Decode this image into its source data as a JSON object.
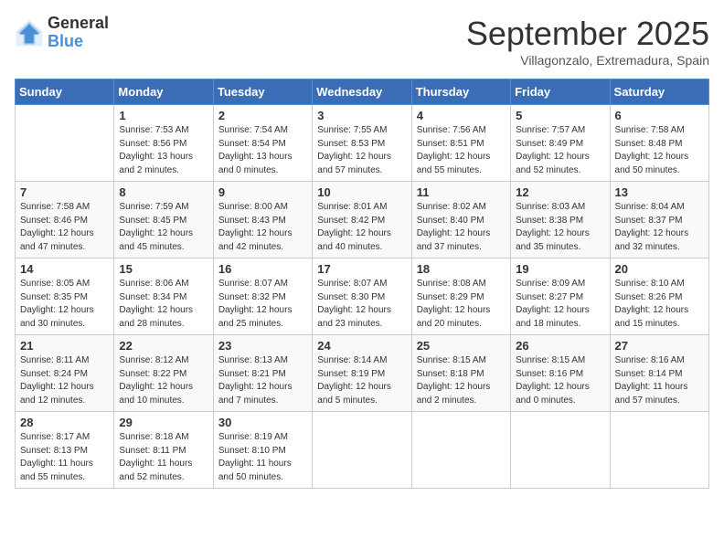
{
  "logo": {
    "general": "General",
    "blue": "Blue"
  },
  "title": "September 2025",
  "subtitle": "Villagonzalo, Extremadura, Spain",
  "weekdays": [
    "Sunday",
    "Monday",
    "Tuesday",
    "Wednesday",
    "Thursday",
    "Friday",
    "Saturday"
  ],
  "weeks": [
    [
      {
        "day": null
      },
      {
        "day": "1",
        "sunrise": "7:53 AM",
        "sunset": "8:56 PM",
        "daylight": "13 hours and 2 minutes."
      },
      {
        "day": "2",
        "sunrise": "7:54 AM",
        "sunset": "8:54 PM",
        "daylight": "13 hours and 0 minutes."
      },
      {
        "day": "3",
        "sunrise": "7:55 AM",
        "sunset": "8:53 PM",
        "daylight": "12 hours and 57 minutes."
      },
      {
        "day": "4",
        "sunrise": "7:56 AM",
        "sunset": "8:51 PM",
        "daylight": "12 hours and 55 minutes."
      },
      {
        "day": "5",
        "sunrise": "7:57 AM",
        "sunset": "8:49 PM",
        "daylight": "12 hours and 52 minutes."
      },
      {
        "day": "6",
        "sunrise": "7:58 AM",
        "sunset": "8:48 PM",
        "daylight": "12 hours and 50 minutes."
      }
    ],
    [
      {
        "day": "7",
        "sunrise": "7:58 AM",
        "sunset": "8:46 PM",
        "daylight": "12 hours and 47 minutes."
      },
      {
        "day": "8",
        "sunrise": "7:59 AM",
        "sunset": "8:45 PM",
        "daylight": "12 hours and 45 minutes."
      },
      {
        "day": "9",
        "sunrise": "8:00 AM",
        "sunset": "8:43 PM",
        "daylight": "12 hours and 42 minutes."
      },
      {
        "day": "10",
        "sunrise": "8:01 AM",
        "sunset": "8:42 PM",
        "daylight": "12 hours and 40 minutes."
      },
      {
        "day": "11",
        "sunrise": "8:02 AM",
        "sunset": "8:40 PM",
        "daylight": "12 hours and 37 minutes."
      },
      {
        "day": "12",
        "sunrise": "8:03 AM",
        "sunset": "8:38 PM",
        "daylight": "12 hours and 35 minutes."
      },
      {
        "day": "13",
        "sunrise": "8:04 AM",
        "sunset": "8:37 PM",
        "daylight": "12 hours and 32 minutes."
      }
    ],
    [
      {
        "day": "14",
        "sunrise": "8:05 AM",
        "sunset": "8:35 PM",
        "daylight": "12 hours and 30 minutes."
      },
      {
        "day": "15",
        "sunrise": "8:06 AM",
        "sunset": "8:34 PM",
        "daylight": "12 hours and 28 minutes."
      },
      {
        "day": "16",
        "sunrise": "8:07 AM",
        "sunset": "8:32 PM",
        "daylight": "12 hours and 25 minutes."
      },
      {
        "day": "17",
        "sunrise": "8:07 AM",
        "sunset": "8:30 PM",
        "daylight": "12 hours and 23 minutes."
      },
      {
        "day": "18",
        "sunrise": "8:08 AM",
        "sunset": "8:29 PM",
        "daylight": "12 hours and 20 minutes."
      },
      {
        "day": "19",
        "sunrise": "8:09 AM",
        "sunset": "8:27 PM",
        "daylight": "12 hours and 18 minutes."
      },
      {
        "day": "20",
        "sunrise": "8:10 AM",
        "sunset": "8:26 PM",
        "daylight": "12 hours and 15 minutes."
      }
    ],
    [
      {
        "day": "21",
        "sunrise": "8:11 AM",
        "sunset": "8:24 PM",
        "daylight": "12 hours and 12 minutes."
      },
      {
        "day": "22",
        "sunrise": "8:12 AM",
        "sunset": "8:22 PM",
        "daylight": "12 hours and 10 minutes."
      },
      {
        "day": "23",
        "sunrise": "8:13 AM",
        "sunset": "8:21 PM",
        "daylight": "12 hours and 7 minutes."
      },
      {
        "day": "24",
        "sunrise": "8:14 AM",
        "sunset": "8:19 PM",
        "daylight": "12 hours and 5 minutes."
      },
      {
        "day": "25",
        "sunrise": "8:15 AM",
        "sunset": "8:18 PM",
        "daylight": "12 hours and 2 minutes."
      },
      {
        "day": "26",
        "sunrise": "8:15 AM",
        "sunset": "8:16 PM",
        "daylight": "12 hours and 0 minutes."
      },
      {
        "day": "27",
        "sunrise": "8:16 AM",
        "sunset": "8:14 PM",
        "daylight": "11 hours and 57 minutes."
      }
    ],
    [
      {
        "day": "28",
        "sunrise": "8:17 AM",
        "sunset": "8:13 PM",
        "daylight": "11 hours and 55 minutes."
      },
      {
        "day": "29",
        "sunrise": "8:18 AM",
        "sunset": "8:11 PM",
        "daylight": "11 hours and 52 minutes."
      },
      {
        "day": "30",
        "sunrise": "8:19 AM",
        "sunset": "8:10 PM",
        "daylight": "11 hours and 50 minutes."
      },
      {
        "day": null
      },
      {
        "day": null
      },
      {
        "day": null
      },
      {
        "day": null
      }
    ]
  ]
}
